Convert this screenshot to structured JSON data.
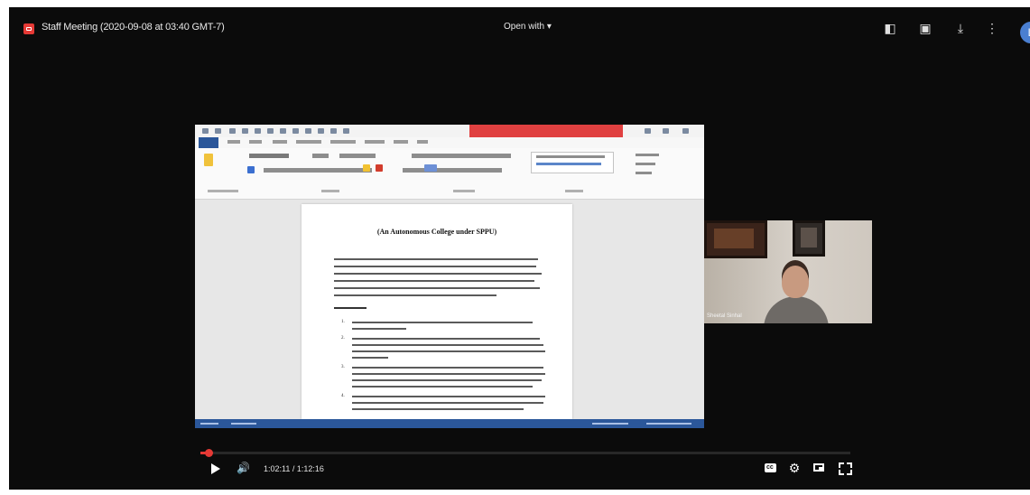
{
  "topbar": {
    "file_title": "Staff Meeting (2020-09-08 at 03:40 GMT-7)",
    "open_with_label": "Open with",
    "icons": [
      "add-to-drive-icon",
      "add-comment-icon",
      "download-icon",
      "more-vert-icon"
    ],
    "avatar_initial": "L"
  },
  "document": {
    "heading": "(An Autonomous College under SPPU)",
    "list_numbers": [
      "1.",
      "2.",
      "3.",
      "4."
    ]
  },
  "participant": {
    "name": "Sheetal Sinhal"
  },
  "player": {
    "time": "1:02:11 / 1:12:16",
    "progress_fraction": 0.012,
    "controls": [
      "play-icon",
      "volume-icon",
      "captions-icon",
      "settings-icon",
      "miniplayer-icon",
      "fullscreen-icon"
    ]
  },
  "colors": {
    "background": "#0b0b0b",
    "accent_red": "#e53935",
    "word_blue": "#2b579a"
  }
}
